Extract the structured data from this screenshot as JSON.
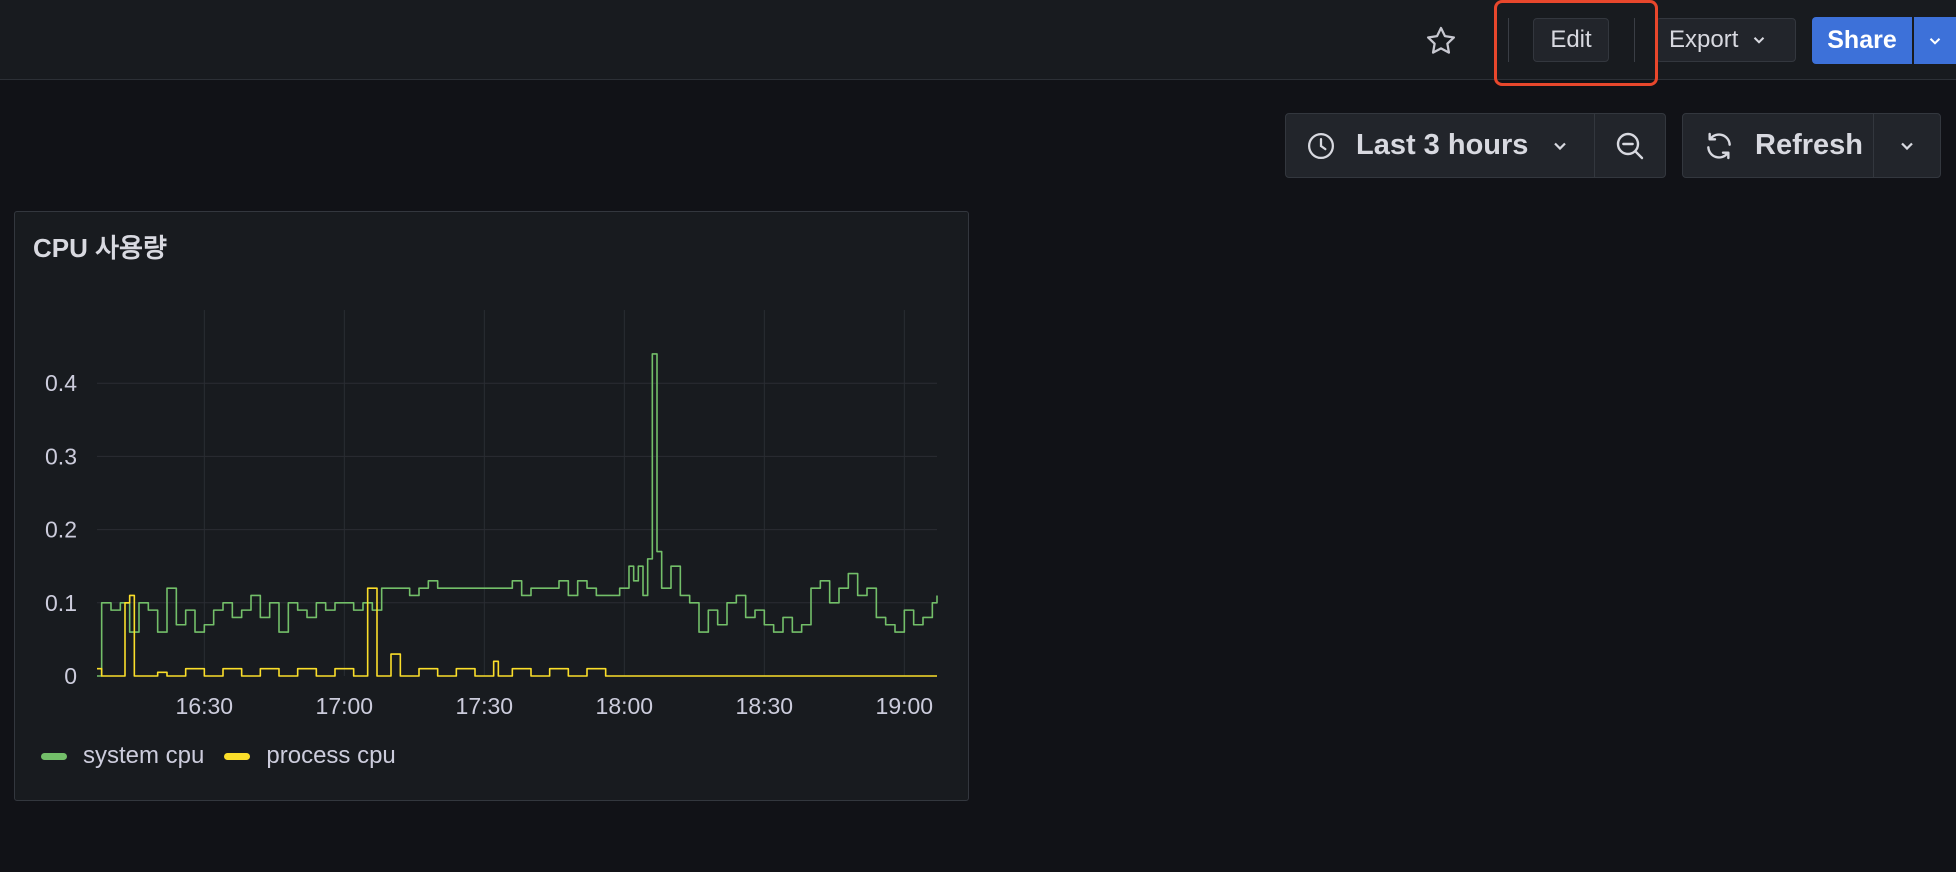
{
  "toolbar": {
    "star_icon": "star-icon",
    "edit_label": "Edit",
    "export_label": "Export",
    "share_label": "Share"
  },
  "time_controls": {
    "range_label": "Last 3 hours",
    "refresh_label": "Refresh"
  },
  "colors": {
    "accent": "#3d71d9",
    "highlight": "#e8472c",
    "system_cpu": "#73bf69",
    "process_cpu": "#fade2a"
  },
  "panel": {
    "title": "CPU 사용량"
  },
  "chart_data": {
    "type": "line",
    "x_ticks": [
      "16:30",
      "17:00",
      "17:30",
      "18:00",
      "18:30",
      "19:00"
    ],
    "y_ticks": [
      "0",
      "0.1",
      "0.2",
      "0.3",
      "0.4"
    ],
    "ylim": [
      0,
      0.5
    ],
    "x_range": [
      "16:07",
      "19:07"
    ],
    "grid": true,
    "legend_position": "bottom-left",
    "series": [
      {
        "name": "system cpu",
        "color": "#73bf69",
        "x": [
          "16:07",
          "16:08",
          "16:10",
          "16:12",
          "16:14",
          "16:16",
          "16:18",
          "16:20",
          "16:22",
          "16:24",
          "16:26",
          "16:28",
          "16:30",
          "16:32",
          "16:34",
          "16:36",
          "16:38",
          "16:40",
          "16:42",
          "16:44",
          "16:46",
          "16:48",
          "16:50",
          "16:52",
          "16:54",
          "16:56",
          "16:58",
          "17:00",
          "17:02",
          "17:04",
          "17:06",
          "17:08",
          "17:10",
          "17:12",
          "17:14",
          "17:16",
          "17:18",
          "17:20",
          "17:22",
          "17:24",
          "17:26",
          "17:28",
          "17:30",
          "17:32",
          "17:34",
          "17:36",
          "17:38",
          "17:40",
          "17:42",
          "17:44",
          "17:46",
          "17:48",
          "17:50",
          "17:52",
          "17:54",
          "17:56",
          "17:58",
          "17:59",
          "18:00",
          "18:01",
          "18:02",
          "18:03",
          "18:04",
          "18:05",
          "18:06",
          "18:07",
          "18:08",
          "18:10",
          "18:12",
          "18:14",
          "18:16",
          "18:18",
          "18:20",
          "18:22",
          "18:24",
          "18:26",
          "18:28",
          "18:30",
          "18:32",
          "18:34",
          "18:36",
          "18:38",
          "18:40",
          "18:42",
          "18:44",
          "18:46",
          "18:48",
          "18:50",
          "18:52",
          "18:54",
          "18:56",
          "18:58",
          "19:00",
          "19:02",
          "19:04",
          "19:06",
          "19:07"
        ],
        "values": [
          0.0,
          0.1,
          0.09,
          0.1,
          0.06,
          0.1,
          0.09,
          0.06,
          0.12,
          0.07,
          0.09,
          0.06,
          0.07,
          0.09,
          0.1,
          0.08,
          0.09,
          0.11,
          0.08,
          0.1,
          0.06,
          0.1,
          0.09,
          0.08,
          0.1,
          0.09,
          0.1,
          0.1,
          0.09,
          0.1,
          0.09,
          0.12,
          0.12,
          0.12,
          0.11,
          0.12,
          0.13,
          0.12,
          0.12,
          0.12,
          0.12,
          0.12,
          0.12,
          0.12,
          0.12,
          0.13,
          0.11,
          0.12,
          0.12,
          0.12,
          0.13,
          0.11,
          0.13,
          0.12,
          0.11,
          0.11,
          0.11,
          0.12,
          0.12,
          0.15,
          0.13,
          0.15,
          0.11,
          0.16,
          0.44,
          0.17,
          0.12,
          0.15,
          0.11,
          0.1,
          0.06,
          0.09,
          0.07,
          0.1,
          0.11,
          0.08,
          0.09,
          0.07,
          0.06,
          0.08,
          0.06,
          0.07,
          0.12,
          0.13,
          0.1,
          0.12,
          0.14,
          0.11,
          0.12,
          0.08,
          0.07,
          0.06,
          0.09,
          0.07,
          0.08,
          0.1,
          0.11
        ]
      },
      {
        "name": "process cpu",
        "color": "#fade2a",
        "x": [
          "16:07",
          "16:08",
          "16:09",
          "16:12",
          "16:13",
          "16:14",
          "16:15",
          "16:16",
          "16:17",
          "16:20",
          "16:22",
          "16:26",
          "16:30",
          "16:34",
          "16:38",
          "16:42",
          "16:46",
          "16:50",
          "16:54",
          "16:58",
          "17:02",
          "17:04",
          "17:05",
          "17:06",
          "17:07",
          "17:08",
          "17:10",
          "17:12",
          "17:16",
          "17:20",
          "17:24",
          "17:28",
          "17:32",
          "17:33",
          "17:36",
          "17:40",
          "17:44",
          "17:48",
          "17:52",
          "17:56",
          "18:00",
          "18:30",
          "19:00",
          "19:07"
        ],
        "values": [
          0.01,
          0.0,
          0.0,
          0.0,
          0.1,
          0.11,
          0.0,
          0.0,
          0.0,
          0.005,
          0.0,
          0.01,
          0.0,
          0.01,
          0.0,
          0.01,
          0.0,
          0.01,
          0.0,
          0.01,
          0.0,
          0.0,
          0.12,
          0.12,
          0.0,
          0.0,
          0.03,
          0.0,
          0.01,
          0.0,
          0.01,
          0.0,
          0.02,
          0.0,
          0.01,
          0.0,
          0.01,
          0.0,
          0.01,
          0.0,
          0.0,
          0.0,
          0.0,
          0.0
        ]
      }
    ]
  }
}
